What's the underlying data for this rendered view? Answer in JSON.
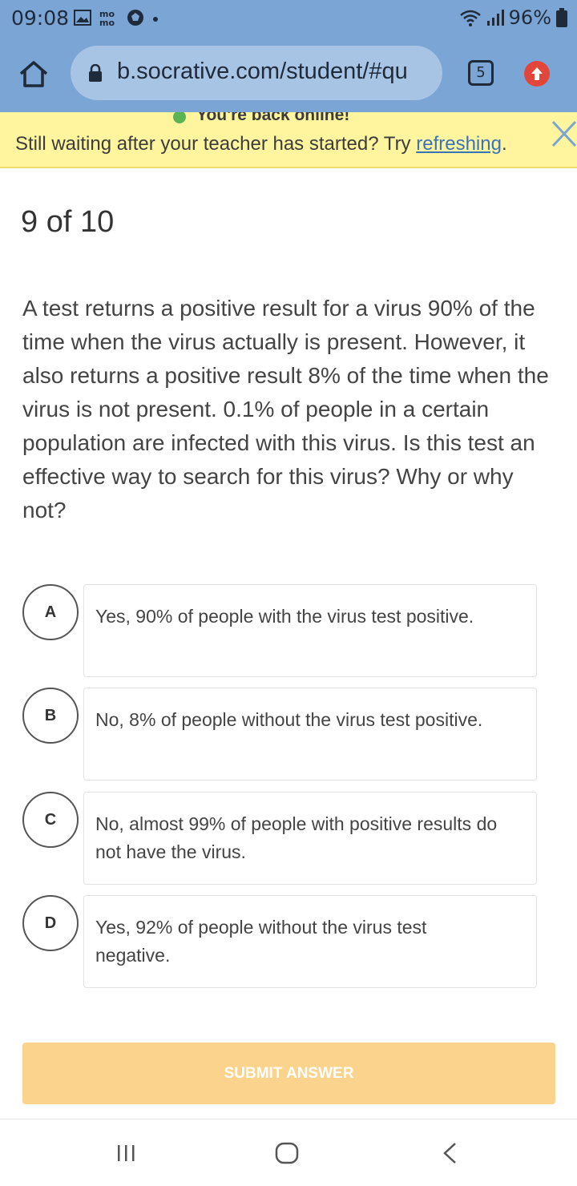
{
  "status_bar": {
    "time": "09:08",
    "battery": "96%",
    "icons_left": [
      "gallery-icon",
      "mo-icon",
      "ball-icon",
      "dot-icon"
    ],
    "icons_right": [
      "wifi-icon",
      "signal-icon",
      "battery-icon"
    ]
  },
  "browser": {
    "url": "b.socrative.com/student/#qu",
    "tab_count": "5"
  },
  "banner": {
    "online_text": "You're back online!",
    "message": "Still waiting after your teacher has started? Try ",
    "link_text": "refreshing",
    "trailing": ".",
    "background_color": "#fff59e"
  },
  "quiz": {
    "progress": "9 of 10",
    "question": "A test returns a positive result for a virus 90% of the time when the virus actually is present. However, it also returns a positive result 8% of the time when the virus is not present. 0.1% of people in a certain population are infected with this virus. Is this test an effective way to search for this virus? Why or why not?",
    "answers": [
      {
        "letter": "A",
        "text": "Yes, 90% of people with the virus test positive."
      },
      {
        "letter": "B",
        "text": "No, 8% of people without the virus test positive."
      },
      {
        "letter": "C",
        "text": "No, almost 99% of people with positive results do not have the virus."
      },
      {
        "letter": "D",
        "text": "Yes, 92% of people without the virus test negative."
      }
    ],
    "submit_label": "SUBMIT ANSWER",
    "submit_color": "#fcd38c"
  },
  "colors": {
    "chrome": "#7ba5d4",
    "link": "#3b73b9",
    "update_badge": "#e2463b"
  }
}
